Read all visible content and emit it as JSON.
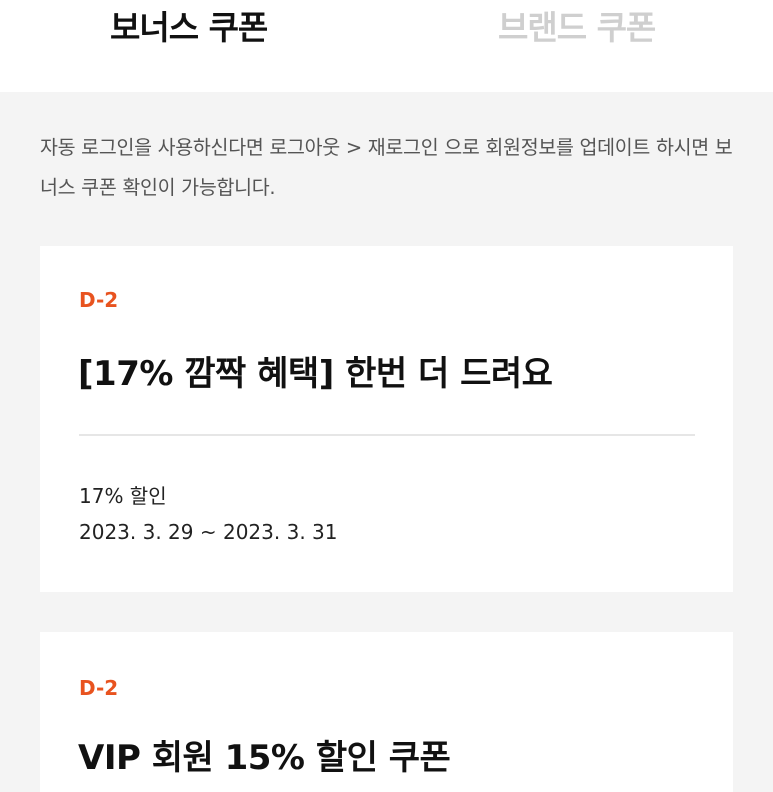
{
  "tabs": [
    {
      "label": "보너스 쿠폰",
      "active": true
    },
    {
      "label": "브랜드 쿠폰",
      "active": false
    }
  ],
  "notice": "자동 로그인을 사용하신다면 로그아웃 > 재로그인 으로 회원정보를 업데이트 하시면 보너스 쿠폰 확인이 가능합니다.",
  "coupons": [
    {
      "dday": "D-2",
      "title": "[17% 깜짝 혜택] 한번 더 드려요",
      "discount": "17% 할인",
      "period": "2023. 3. 29 ~ 2023. 3. 31"
    },
    {
      "dday": "D-2",
      "title": "VIP 회원 15% 할인 쿠폰"
    }
  ],
  "colors": {
    "accent": "#e8531f",
    "background": "#f4f4f4",
    "tab_inactive": "#cfcfcf"
  }
}
